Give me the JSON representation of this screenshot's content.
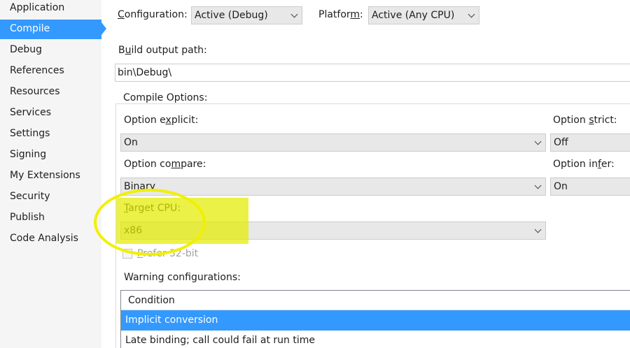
{
  "sidebar": {
    "items": [
      {
        "label": "Application",
        "selected": false
      },
      {
        "label": "Compile",
        "selected": true
      },
      {
        "label": "Debug",
        "selected": false
      },
      {
        "label": "References",
        "selected": false
      },
      {
        "label": "Resources",
        "selected": false
      },
      {
        "label": "Services",
        "selected": false
      },
      {
        "label": "Settings",
        "selected": false
      },
      {
        "label": "Signing",
        "selected": false
      },
      {
        "label": "My Extensions",
        "selected": false
      },
      {
        "label": "Security",
        "selected": false
      },
      {
        "label": "Publish",
        "selected": false
      },
      {
        "label": "Code Analysis",
        "selected": false
      }
    ]
  },
  "toolbar": {
    "configuration_label_pre": "",
    "configuration_label_key": "C",
    "configuration_label_post": "onfiguration:",
    "configuration_value": "Active (Debug)",
    "platform_label_pre": "Platfor",
    "platform_label_key": "m",
    "platform_label_post": ":",
    "platform_value": "Active (Any CPU)"
  },
  "build": {
    "label_pre": "B",
    "label_key": "u",
    "label_post": "ild output path:",
    "path": "bin\\Debug\\"
  },
  "compile_options": {
    "title": "Compile Options:",
    "option_explicit_pre": "Option e",
    "option_explicit_key": "x",
    "option_explicit_post": "plicit:",
    "option_explicit_value": "On",
    "option_strict_pre": "Option ",
    "option_strict_key": "s",
    "option_strict_post": "trict:",
    "option_strict_value": "Off",
    "option_compare_pre": "Option co",
    "option_compare_key": "m",
    "option_compare_post": "pare:",
    "option_compare_value": "Binary",
    "option_infer_pre": "Option in",
    "option_infer_key": "f",
    "option_infer_post": "er:",
    "option_infer_value": "On",
    "target_cpu_pre": "",
    "target_cpu_key": "T",
    "target_cpu_post": "arget CPU:",
    "target_cpu_value": "x86",
    "prefer32_pre": "",
    "prefer32_key": "P",
    "prefer32_post": "refer 32-bit",
    "prefer32_checked": false
  },
  "warnings": {
    "label": "Warning configurations:",
    "header": "Condition",
    "rows": [
      {
        "text": "Implicit conversion",
        "selected": true
      },
      {
        "text": "Late binding; call could fail at run time",
        "selected": false
      }
    ]
  },
  "annotation": {
    "highlight_color": "#e4eb00",
    "circle_color": "#f0f000"
  }
}
